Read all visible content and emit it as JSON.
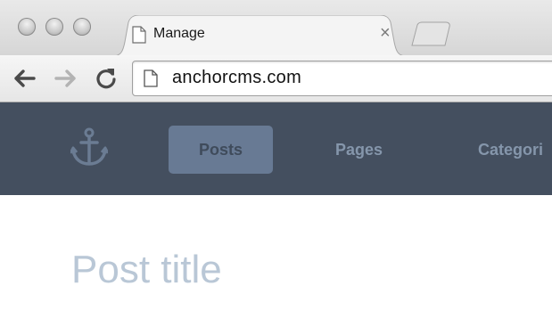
{
  "browser": {
    "tab": {
      "title": "Manage",
      "close_glyph": "×",
      "icon": "page-icon"
    },
    "window_controls": [
      "close",
      "minimize",
      "zoom"
    ],
    "toolbar": {
      "back_icon": "back-arrow-icon",
      "forward_icon": "forward-arrow-icon",
      "reload_icon": "reload-icon"
    },
    "address_bar": {
      "url": "anchorcms.com",
      "icon": "page-icon"
    }
  },
  "site": {
    "logo_icon": "anchor-icon",
    "nav": [
      {
        "label": "Posts",
        "active": true
      },
      {
        "label": "Pages",
        "active": false
      },
      {
        "label": "Categori",
        "active": false
      }
    ]
  },
  "editor": {
    "title_placeholder": "Post title"
  },
  "colors": {
    "header_bg": "#444f5f",
    "nav_active_bg": "#687a94",
    "nav_text": "#8596ab",
    "placeholder": "#b9c7d6"
  }
}
